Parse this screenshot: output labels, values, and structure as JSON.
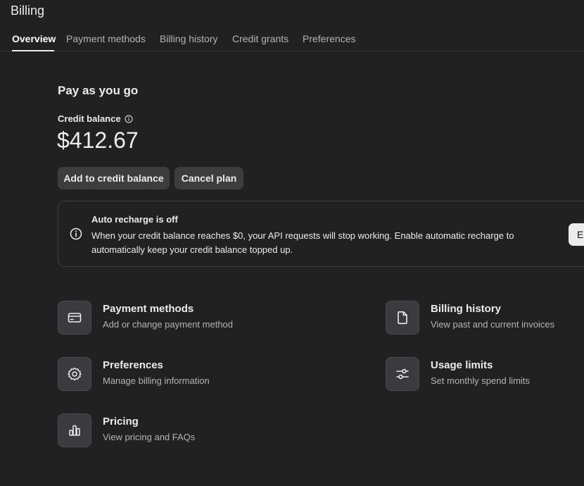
{
  "page": {
    "title": "Billing"
  },
  "tabs": [
    {
      "label": "Overview"
    },
    {
      "label": "Payment methods"
    },
    {
      "label": "Billing history"
    },
    {
      "label": "Credit grants"
    },
    {
      "label": "Preferences"
    }
  ],
  "plan": {
    "title": "Pay as you go",
    "balance_label": "Credit balance",
    "balance_value": "$412.67",
    "add_button": "Add to credit balance",
    "cancel_button": "Cancel plan"
  },
  "alert": {
    "icon": "info-icon",
    "title": "Auto recharge is off",
    "text": "When your credit balance reaches $0, your API requests will stop working. Enable automatic recharge to automatically keep your credit balance topped up.",
    "button": "Enable auto recharge"
  },
  "cards": [
    {
      "title": "Payment methods",
      "subtitle": "Add or change payment method",
      "icon": "credit-card-icon"
    },
    {
      "title": "Billing history",
      "subtitle": "View past and current invoices",
      "icon": "document-icon"
    },
    {
      "title": "Preferences",
      "subtitle": "Manage billing information",
      "icon": "gear-icon"
    },
    {
      "title": "Usage limits",
      "subtitle": "Set monthly spend limits",
      "icon": "sliders-icon"
    },
    {
      "title": "Pricing",
      "subtitle": "View pricing and FAQs",
      "icon": "bar-chart-icon"
    }
  ],
  "colors": {
    "background": "#212121",
    "card_icon_bg": "#3a3a3f",
    "button_bg": "#3d3d3d"
  }
}
